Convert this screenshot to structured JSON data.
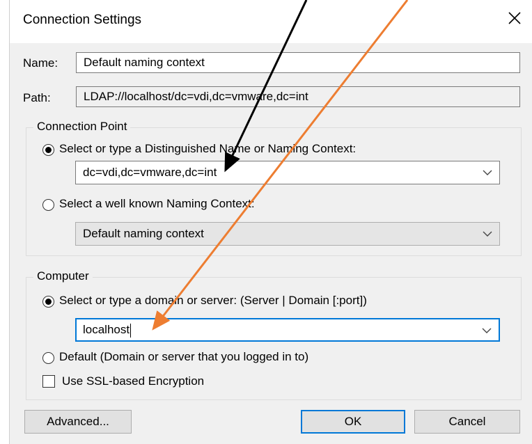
{
  "dialog": {
    "title": "Connection Settings",
    "close_icon": "close-icon"
  },
  "name": {
    "label": "Name:",
    "value": "Default naming context"
  },
  "path": {
    "label": "Path:",
    "value": "LDAP://localhost/dc=vdi,dc=vmware,dc=int"
  },
  "connection_point": {
    "title": "Connection Point",
    "option_dn": {
      "label": "Select or type a Distinguished Name or Naming Context:",
      "selected": true
    },
    "dn_value": "dc=vdi,dc=vmware,dc=int",
    "option_well_known": {
      "label": "Select a well known Naming Context:",
      "selected": false
    },
    "well_known_value": "Default naming context"
  },
  "computer": {
    "title": "Computer",
    "option_server": {
      "label": "Select or type a domain or server: (Server | Domain [:port])",
      "selected": true
    },
    "server_value": "localhost",
    "option_default": {
      "label": "Default (Domain or server that you logged in to)",
      "selected": false
    },
    "ssl": {
      "label": "Use SSL-based Encryption",
      "checked": false
    }
  },
  "buttons": {
    "advanced": "Advanced...",
    "ok": "OK",
    "cancel": "Cancel"
  },
  "annotations": {
    "arrow1_color": "#000000",
    "arrow2_color": "#ed7d31"
  }
}
